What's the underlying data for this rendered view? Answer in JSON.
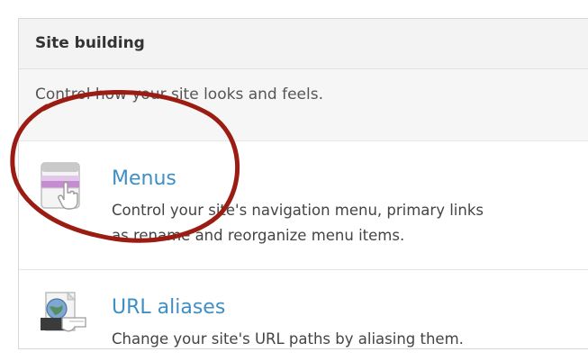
{
  "panel": {
    "title": "Site building",
    "description": "Control how your site looks and feels.",
    "items": [
      {
        "title": "Menus",
        "description_line1": "Control your site's navigation menu, primary links",
        "description_line2": "as rename and reorganize menu items.",
        "icon": "menus-icon"
      },
      {
        "title": "URL aliases",
        "description_line1": "Change your site's URL paths by aliasing them.",
        "icon": "url-aliases-icon"
      }
    ]
  },
  "colors": {
    "link": "#3e8fc6",
    "annotation_circle": "#9b1c12"
  }
}
